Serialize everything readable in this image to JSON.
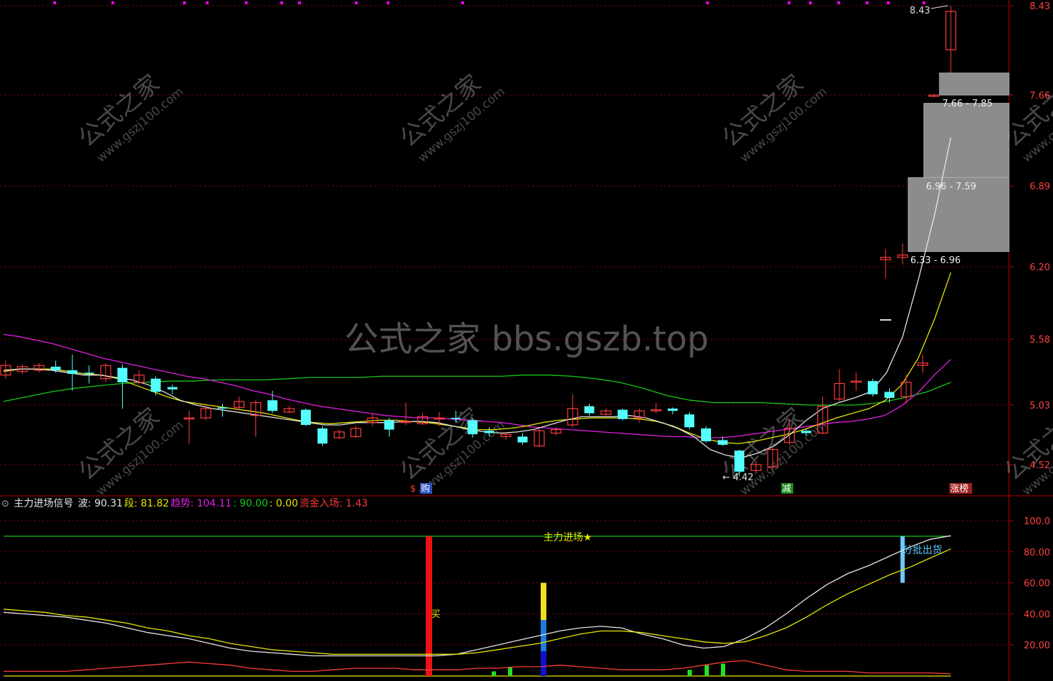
{
  "colors": {
    "background": "#000000",
    "grid": "#8b0000",
    "frame": "#c00000",
    "up_candle": "#ff3b3b",
    "down_candle": "#54ffff",
    "ma_white": "#e6e6e6",
    "ma_yellow": "#e6e600",
    "ma_magenta": "#e020e0",
    "ma_green": "#18c818",
    "band_gray": "#8c8c8c",
    "watermark": "#ffffff",
    "dot_magenta": "#ff00ff"
  },
  "watermark": {
    "center_text": "公式之家 bbs.gszb.top",
    "tile_cn": "公式之家",
    "tile_url": "www.gszj100.com"
  },
  "main_panel": {
    "price_ticks": [
      "8.43",
      "7.66",
      "6.89",
      "6.20",
      "5.58",
      "5.03",
      "4.52"
    ],
    "annotations": {
      "high_label": "8.43",
      "low_label": "4.42",
      "zone_labels": [
        "7.66 - 7.85",
        "6.96 - 7.59",
        "6.33 - 6.96"
      ]
    },
    "markers": [
      {
        "text": "$",
        "color": "#ff3b3b"
      },
      {
        "text": "购",
        "color": "#ffffff"
      },
      {
        "text": "减",
        "color": "#ffffff"
      },
      {
        "text": "涨榜",
        "color": "#ffffff"
      }
    ]
  },
  "indicator_bar": {
    "title": "主力进场信号",
    "items": [
      {
        "label": "波:",
        "value": "90.31",
        "color": "#e6e6e6"
      },
      {
        "label": "段:",
        "value": "81.82",
        "color": "#e6e600"
      },
      {
        "label": "趋势:",
        "value": "104.11",
        "color": "#e020e0"
      },
      {
        "label": ":",
        "value": "90.00",
        "color": "#18c818"
      },
      {
        "label": ":",
        "value": "0.00",
        "color": "#e6e600"
      },
      {
        "label": "资金入场:",
        "value": "1.43",
        "color": "#ff3b3b"
      }
    ]
  },
  "sub_panel": {
    "ticks": [
      "100.0",
      "80.00",
      "60.00",
      "40.00",
      "20.00"
    ],
    "labels": {
      "main_entry": "主力进场★",
      "buy": "买",
      "sell": "分批出货"
    }
  },
  "chart_data": [
    {
      "type": "candlestick",
      "title": "",
      "ylim": [
        4.35,
        8.5
      ],
      "y_ticks": [
        8.43,
        7.66,
        6.89,
        6.2,
        5.58,
        5.03,
        4.52
      ],
      "candles": [
        {
          "o": 5.28,
          "c": 5.36,
          "h": 5.4,
          "l": 5.25
        },
        {
          "o": 5.31,
          "c": 5.35,
          "h": 5.37,
          "l": 5.29
        },
        {
          "o": 5.32,
          "c": 5.36,
          "h": 5.38,
          "l": 5.3
        },
        {
          "o": 5.35,
          "c": 5.32,
          "h": 5.4,
          "l": 5.3
        },
        {
          "o": 5.32,
          "c": 5.29,
          "h": 5.45,
          "l": 5.15
        },
        {
          "o": 5.3,
          "c": 5.29,
          "h": 5.36,
          "l": 5.21
        },
        {
          "o": 5.25,
          "c": 5.36,
          "h": 5.38,
          "l": 5.22
        },
        {
          "o": 5.34,
          "c": 5.22,
          "h": 5.37,
          "l": 5.0
        },
        {
          "o": 5.22,
          "c": 5.28,
          "h": 5.32,
          "l": 5.2
        },
        {
          "o": 5.25,
          "c": 5.14,
          "h": 5.27,
          "l": 5.11
        },
        {
          "o": 5.18,
          "c": 5.16,
          "h": 5.2,
          "l": 5.12
        },
        {
          "o": 4.92,
          "c": 4.92,
          "h": 4.98,
          "l": 4.7
        },
        {
          "o": 4.92,
          "c": 5.0,
          "h": 5.04,
          "l": 4.9
        },
        {
          "o": 5.01,
          "c": 5.0,
          "h": 5.04,
          "l": 4.93
        },
        {
          "o": 5.01,
          "c": 5.06,
          "h": 5.1,
          "l": 4.98
        },
        {
          "o": 4.94,
          "c": 5.05,
          "h": 5.07,
          "l": 4.76
        },
        {
          "o": 5.07,
          "c": 4.98,
          "h": 5.15,
          "l": 4.96
        },
        {
          "o": 4.97,
          "c": 5.0,
          "h": 5.02,
          "l": 4.96
        },
        {
          "o": 4.99,
          "c": 4.86,
          "h": 5.0,
          "l": 4.85
        },
        {
          "o": 4.83,
          "c": 4.7,
          "h": 4.85,
          "l": 4.68
        },
        {
          "o": 4.75,
          "c": 4.8,
          "h": 4.82,
          "l": 4.74
        },
        {
          "o": 4.76,
          "c": 4.83,
          "h": 4.85,
          "l": 4.75
        },
        {
          "o": 4.88,
          "c": 4.92,
          "h": 4.96,
          "l": 4.85
        },
        {
          "o": 4.9,
          "c": 4.82,
          "h": 4.92,
          "l": 4.76
        },
        {
          "o": 4.88,
          "c": 4.89,
          "h": 5.05,
          "l": 4.86
        },
        {
          "o": 4.87,
          "c": 4.93,
          "h": 4.96,
          "l": 4.86
        },
        {
          "o": 4.91,
          "c": 4.92,
          "h": 4.97,
          "l": 4.85
        },
        {
          "o": 4.92,
          "c": 4.91,
          "h": 4.98,
          "l": 4.88
        },
        {
          "o": 4.9,
          "c": 4.78,
          "h": 4.92,
          "l": 4.75
        },
        {
          "o": 4.81,
          "c": 4.79,
          "h": 4.84,
          "l": 4.76
        },
        {
          "o": 4.76,
          "c": 4.78,
          "h": 4.8,
          "l": 4.73
        },
        {
          "o": 4.76,
          "c": 4.71,
          "h": 4.79,
          "l": 4.69
        },
        {
          "o": 4.68,
          "c": 4.81,
          "h": 4.83,
          "l": 4.67
        },
        {
          "o": 4.79,
          "c": 4.82,
          "h": 4.84,
          "l": 4.77
        },
        {
          "o": 4.86,
          "c": 5.0,
          "h": 5.12,
          "l": 4.84
        },
        {
          "o": 5.02,
          "c": 4.96,
          "h": 5.04,
          "l": 4.94
        },
        {
          "o": 4.95,
          "c": 4.98,
          "h": 5.0,
          "l": 4.93
        },
        {
          "o": 4.99,
          "c": 4.91,
          "h": 5.0,
          "l": 4.9
        },
        {
          "o": 4.92,
          "c": 4.98,
          "h": 5.0,
          "l": 4.88
        },
        {
          "o": 4.98,
          "c": 4.99,
          "h": 5.05,
          "l": 4.96
        },
        {
          "o": 5.0,
          "c": 4.98,
          "h": 5.01,
          "l": 4.95
        },
        {
          "o": 4.95,
          "c": 4.84,
          "h": 4.97,
          "l": 4.82
        },
        {
          "o": 4.83,
          "c": 4.72,
          "h": 4.85,
          "l": 4.71
        },
        {
          "o": 4.73,
          "c": 4.69,
          "h": 4.76,
          "l": 4.68
        },
        {
          "o": 4.64,
          "c": 4.46,
          "h": 4.65,
          "l": 4.42
        },
        {
          "o": 4.47,
          "c": 4.52,
          "h": 4.55,
          "l": 4.44
        },
        {
          "o": 4.5,
          "c": 4.65,
          "h": 4.67,
          "l": 4.48
        },
        {
          "o": 4.71,
          "c": 4.83,
          "h": 4.91,
          "l": 4.69
        },
        {
          "o": 4.81,
          "c": 4.79,
          "h": 4.83,
          "l": 4.77
        },
        {
          "o": 4.79,
          "c": 5.02,
          "h": 5.1,
          "l": 4.78
        },
        {
          "o": 5.08,
          "c": 5.21,
          "h": 5.33,
          "l": 5.06
        },
        {
          "o": 5.22,
          "c": 5.23,
          "h": 5.3,
          "l": 5.15
        },
        {
          "o": 5.23,
          "c": 5.12,
          "h": 5.25,
          "l": 5.1
        },
        {
          "o": 5.14,
          "c": 5.09,
          "h": 5.17,
          "l": 5.05
        },
        {
          "o": 5.1,
          "c": 5.22,
          "h": 5.28,
          "l": 5.04
        },
        {
          "o": 5.36,
          "c": 5.38,
          "h": 5.45,
          "l": 5.3
        },
        {
          "o": 6.26,
          "c": 6.28,
          "h": 6.35,
          "l": 6.1
        },
        {
          "o": 6.28,
          "c": 6.3,
          "h": 6.4,
          "l": 6.22
        },
        {
          "o": 7.65,
          "c": 7.66,
          "h": 7.67,
          "l": 7.64
        },
        {
          "o": 8.05,
          "c": 8.38,
          "h": 8.43,
          "l": 7.85
        }
      ],
      "ma_white": [
        5.32,
        5.33,
        5.33,
        5.32,
        5.3,
        5.28,
        5.28,
        5.26,
        5.24,
        5.2,
        5.14,
        5.07,
        5.03,
        5.0,
        4.98,
        4.96,
        4.94,
        4.92,
        4.9,
        4.88,
        4.86,
        4.86,
        4.88,
        4.88,
        4.88,
        4.89,
        4.89,
        4.88,
        4.85,
        4.82,
        4.8,
        4.79,
        4.8,
        4.82,
        4.86,
        4.9,
        4.93,
        4.93,
        4.93,
        4.94,
        4.92,
        4.88,
        4.83,
        4.76,
        4.65,
        4.6,
        4.58,
        4.62,
        4.68,
        4.78,
        4.9,
        5.0,
        5.05,
        5.09,
        5.14,
        5.3,
        5.6,
        6.1,
        6.65,
        7.3
      ],
      "ma_yellow": [
        5.31,
        5.33,
        5.33,
        5.33,
        5.31,
        5.29,
        5.28,
        5.25,
        5.2,
        5.15,
        5.1,
        5.06,
        5.04,
        5.02,
        5.0,
        4.98,
        4.96,
        4.93,
        4.9,
        4.88,
        4.87,
        4.88,
        4.89,
        4.9,
        4.9,
        4.89,
        4.88,
        4.86,
        4.84,
        4.82,
        4.82,
        4.83,
        4.85,
        4.88,
        4.9,
        4.91,
        4.92,
        4.92,
        4.92,
        4.91,
        4.89,
        4.85,
        4.79,
        4.74,
        4.71,
        4.7,
        4.72,
        4.75,
        4.78,
        4.82,
        4.87,
        4.92,
        4.96,
        5.0,
        5.07,
        5.2,
        5.42,
        5.75,
        6.15
      ],
      "ma_magenta": [
        5.62,
        5.6,
        5.57,
        5.54,
        5.5,
        5.46,
        5.42,
        5.39,
        5.36,
        5.33,
        5.3,
        5.27,
        5.25,
        5.22,
        5.19,
        5.15,
        5.12,
        5.08,
        5.05,
        5.02,
        5.0,
        4.98,
        4.96,
        4.94,
        4.93,
        4.92,
        4.92,
        4.91,
        4.9,
        4.89,
        4.88,
        4.86,
        4.84,
        4.83,
        4.82,
        4.81,
        4.8,
        4.79,
        4.78,
        4.77,
        4.76,
        4.76,
        4.75,
        4.75,
        4.76,
        4.78,
        4.8,
        4.82,
        4.84,
        4.86,
        4.88,
        4.89,
        4.91,
        4.94,
        5.02,
        5.13,
        5.28,
        5.41
      ],
      "ma_green": [
        5.06,
        5.1,
        5.14,
        5.17,
        5.19,
        5.21,
        5.22,
        5.23,
        5.23,
        5.24,
        5.24,
        5.24,
        5.25,
        5.26,
        5.26,
        5.26,
        5.27,
        5.27,
        5.27,
        5.27,
        5.27,
        5.27,
        5.28,
        5.28,
        5.27,
        5.25,
        5.22,
        5.17,
        5.11,
        5.07,
        5.05,
        5.05,
        5.05,
        5.04,
        5.03,
        5.03,
        5.03,
        5.05,
        5.09,
        5.14,
        5.22
      ],
      "zones": [
        {
          "label": "7.66 - 7.85",
          "low": 7.66,
          "high": 7.85
        },
        {
          "label": "6.96 - 7.59",
          "low": 6.96,
          "high": 7.59
        },
        {
          "label": "6.33 - 6.96",
          "low": 6.33,
          "high": 6.96
        }
      ]
    },
    {
      "type": "line",
      "title": "主力进场信号",
      "ylim": [
        0,
        110
      ],
      "y_ticks": [
        100,
        80,
        60,
        40,
        20
      ],
      "series": [
        {
          "name": "波",
          "color": "#e6e6e6",
          "values": [
            41,
            40,
            39,
            38,
            36,
            34,
            31,
            28,
            26,
            24,
            21,
            18,
            16,
            15,
            14,
            13,
            13,
            13,
            13,
            13,
            13,
            13,
            14,
            17,
            20,
            23,
            26,
            29,
            31,
            32,
            31,
            27,
            24,
            20,
            18,
            19,
            24,
            31,
            40,
            50,
            59,
            66,
            71,
            77,
            83,
            88,
            90.31
          ]
        },
        {
          "name": "段",
          "color": "#e6e600",
          "values": [
            43,
            42,
            41,
            39,
            38,
            36,
            34,
            31,
            29,
            26,
            24,
            21,
            19,
            17,
            16,
            15,
            14,
            14,
            14,
            14,
            14,
            14,
            14,
            15,
            17,
            19,
            21,
            24,
            27,
            29,
            29,
            28,
            26,
            24,
            22,
            21,
            22,
            26,
            31,
            38,
            46,
            53,
            59,
            65,
            70,
            76,
            81.82
          ]
        },
        {
          "name": "资金入场",
          "color": "#ff3b3b",
          "values": [
            3,
            3,
            3,
            3,
            4,
            5,
            6,
            7,
            8,
            9,
            8,
            7,
            5,
            4,
            3,
            3,
            4,
            5,
            5,
            5,
            4,
            4,
            4,
            5,
            5,
            6,
            6,
            7,
            6,
            5,
            4,
            4,
            4,
            5,
            7,
            9,
            10,
            7,
            4,
            3,
            3,
            3,
            2,
            2,
            2,
            2,
            1.43
          ]
        }
      ],
      "h_lines": [
        {
          "value": 90,
          "color": "#18c818",
          "label": "主力进场★"
        },
        {
          "value": 0,
          "color": "#e6e600"
        }
      ]
    }
  ]
}
